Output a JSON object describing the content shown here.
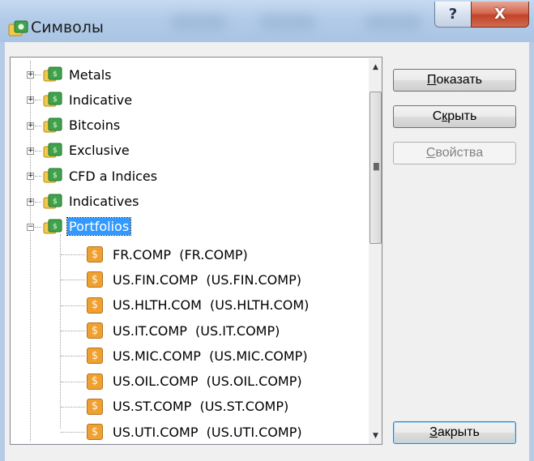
{
  "window": {
    "title": "Символы",
    "help_glyph": "?",
    "close_glyph": "X"
  },
  "tree": {
    "groups": [
      {
        "label": "Metals",
        "expander": "+"
      },
      {
        "label": "Indicative",
        "expander": "+"
      },
      {
        "label": "Bitcoins",
        "expander": "+"
      },
      {
        "label": "Exclusive",
        "expander": "+"
      },
      {
        "label": "CFD a Indices",
        "expander": "+"
      },
      {
        "label": "Indicatives",
        "expander": "+"
      },
      {
        "label": "Portfolios",
        "expander": "−",
        "selected": true
      }
    ],
    "symbols": [
      {
        "label": "FR.COMP  (FR.COMP)"
      },
      {
        "label": "US.FIN.COMP  (US.FIN.COMP)"
      },
      {
        "label": "US.HLTH.COM  (US.HLTH.COM)"
      },
      {
        "label": "US.IT.COMP  (US.IT.COMP)"
      },
      {
        "label": "US.MIC.COMP  (US.MIC.COMP)"
      },
      {
        "label": "US.OIL.COMP  (US.OIL.COMP)"
      },
      {
        "label": "US.ST.COMP  (US.ST.COMP)"
      },
      {
        "label": "US.UTI.COMP  (US.UTI.COMP)"
      }
    ],
    "symbol_icon_glyph": "$"
  },
  "buttons": {
    "show": {
      "accel": "П",
      "rest": "оказать"
    },
    "hide": {
      "pre": "С",
      "accel": "к",
      "rest": "рыть"
    },
    "properties": {
      "accel": "С",
      "rest": "войства"
    },
    "close": {
      "accel": "З",
      "rest": "акрыть"
    }
  },
  "colors": {
    "selection": "#3399ff",
    "folder_green": "#3fa34a",
    "folder_yellow": "#f2c94c",
    "coin_orange": "#f0a030"
  }
}
